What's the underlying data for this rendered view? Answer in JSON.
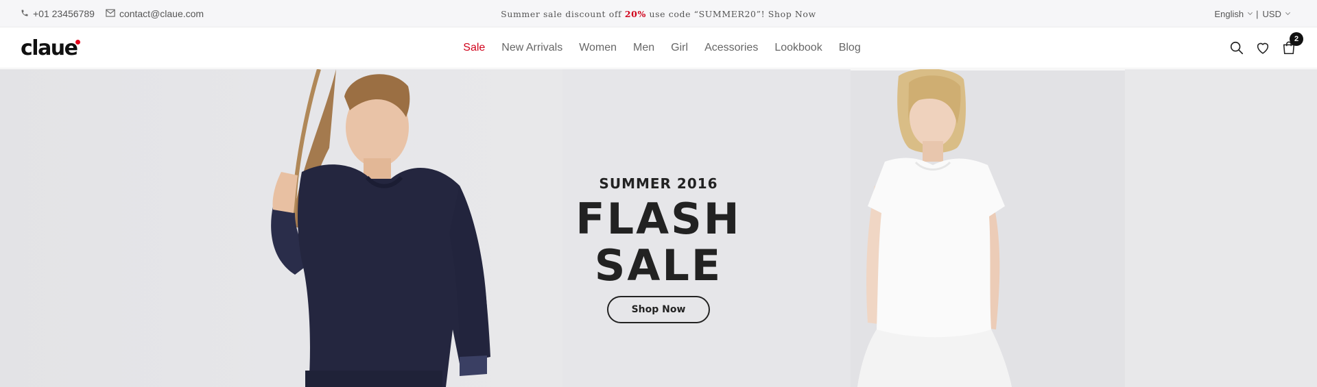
{
  "topbar": {
    "phone": "+01 23456789",
    "email": "contact@claue.com",
    "promo_before": "Summer sale discount off ",
    "promo_pct": "20%",
    "promo_after": " use code “SUMMER20”! Shop Now",
    "language": "English",
    "separator": "|",
    "currency": "USD"
  },
  "header": {
    "logo": "claue",
    "nav": [
      "Sale",
      "New Arrivals",
      "Women",
      "Men",
      "Girl",
      "Acessories",
      "Lookbook",
      "Blog"
    ],
    "cart_count": "2"
  },
  "hero": {
    "subtitle": "SUMMER 2016",
    "title": "FLASH SALE",
    "button": "Shop Now"
  },
  "colors": {
    "accent": "#d0021b",
    "text_dark": "#222222",
    "topbar_bg": "#f6f6f8",
    "hero_bg": "#e6e6e9"
  },
  "icons": [
    "phone-icon",
    "mail-icon",
    "search-icon",
    "heart-icon",
    "cart-icon"
  ]
}
